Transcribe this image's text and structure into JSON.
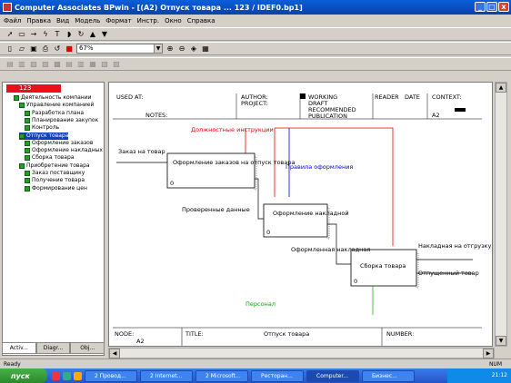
{
  "window": {
    "title": "Computer Associates BPwin - [(A2) Отпуск товара ... 123 / IDEF0.bp1]",
    "buttons": [
      "_",
      "□",
      "x"
    ]
  },
  "menu": [
    "Файл",
    "Правка",
    "Вид",
    "Модель",
    "Формат",
    "Инстр.",
    "Окно",
    "Справка"
  ],
  "toolbar": {
    "zoom": "67%"
  },
  "explorer": {
    "root_label": "123",
    "items": [
      {
        "label": "Деятельность компании",
        "level": 1,
        "selected": false
      },
      {
        "label": "Управление компанией",
        "level": 2,
        "selected": false
      },
      {
        "label": "Разработка плана",
        "level": 3,
        "selected": false
      },
      {
        "label": "Планирование закупок",
        "level": 3,
        "selected": false
      },
      {
        "label": "Контроль",
        "level": 3,
        "selected": false
      },
      {
        "label": "Отпуск товара",
        "level": 2,
        "selected": true
      },
      {
        "label": "Оформление заказов",
        "level": 3,
        "selected": false
      },
      {
        "label": "Оформление накладных",
        "level": 3,
        "selected": false
      },
      {
        "label": "Сборка товара",
        "level": 3,
        "selected": false
      },
      {
        "label": "Приобретение товара",
        "level": 2,
        "selected": false
      },
      {
        "label": "Заказ поставщику",
        "level": 3,
        "selected": false
      },
      {
        "label": "Получение товара",
        "level": 3,
        "selected": false
      },
      {
        "label": "Формирование цен",
        "level": 3,
        "selected": false
      }
    ],
    "tabs": [
      "Activ...",
      "Diagr...",
      "Obj..."
    ]
  },
  "diagram": {
    "header_left": [
      "USED AT:",
      "AUTHOR:",
      "PROJECT:",
      "NOTES:"
    ],
    "header_right": [
      "WORKING",
      "DRAFT",
      "RECOMMENDED",
      "PUBLICATION"
    ],
    "header_reader": [
      "READER",
      "DATE",
      "CONTEXT:"
    ],
    "node_ref": "A2",
    "arrows": {
      "control_red": "Должностные инструкции",
      "control_blue": "Правила оформления",
      "input": "Заказ на товар",
      "out1": "Проверенные данные",
      "out2": "Оформленная накладная",
      "out3a": "Накладная на отгрузку",
      "out3b": "Отпущенный товар",
      "mech": "Персонал"
    },
    "boxes": [
      {
        "label": "Оформление заказов на отпуск товара",
        "num": "0"
      },
      {
        "label": "Оформление накладной",
        "num": "0"
      },
      {
        "label": "Сборка товара",
        "num": "0"
      }
    ],
    "footer": [
      "NODE:",
      "TITLE:",
      "Отпуск товара",
      "NUMBER:"
    ],
    "footer_node": "A2"
  },
  "status": {
    "left": "Ready",
    "right": "NUM"
  },
  "taskbar": {
    "start": "пуск",
    "tasks": [
      "2 Провод...",
      "2 Internet...",
      "2 Microsoft...",
      "Ресторан...",
      "Computer...",
      "Бизнес..."
    ],
    "clock": "21:12"
  }
}
